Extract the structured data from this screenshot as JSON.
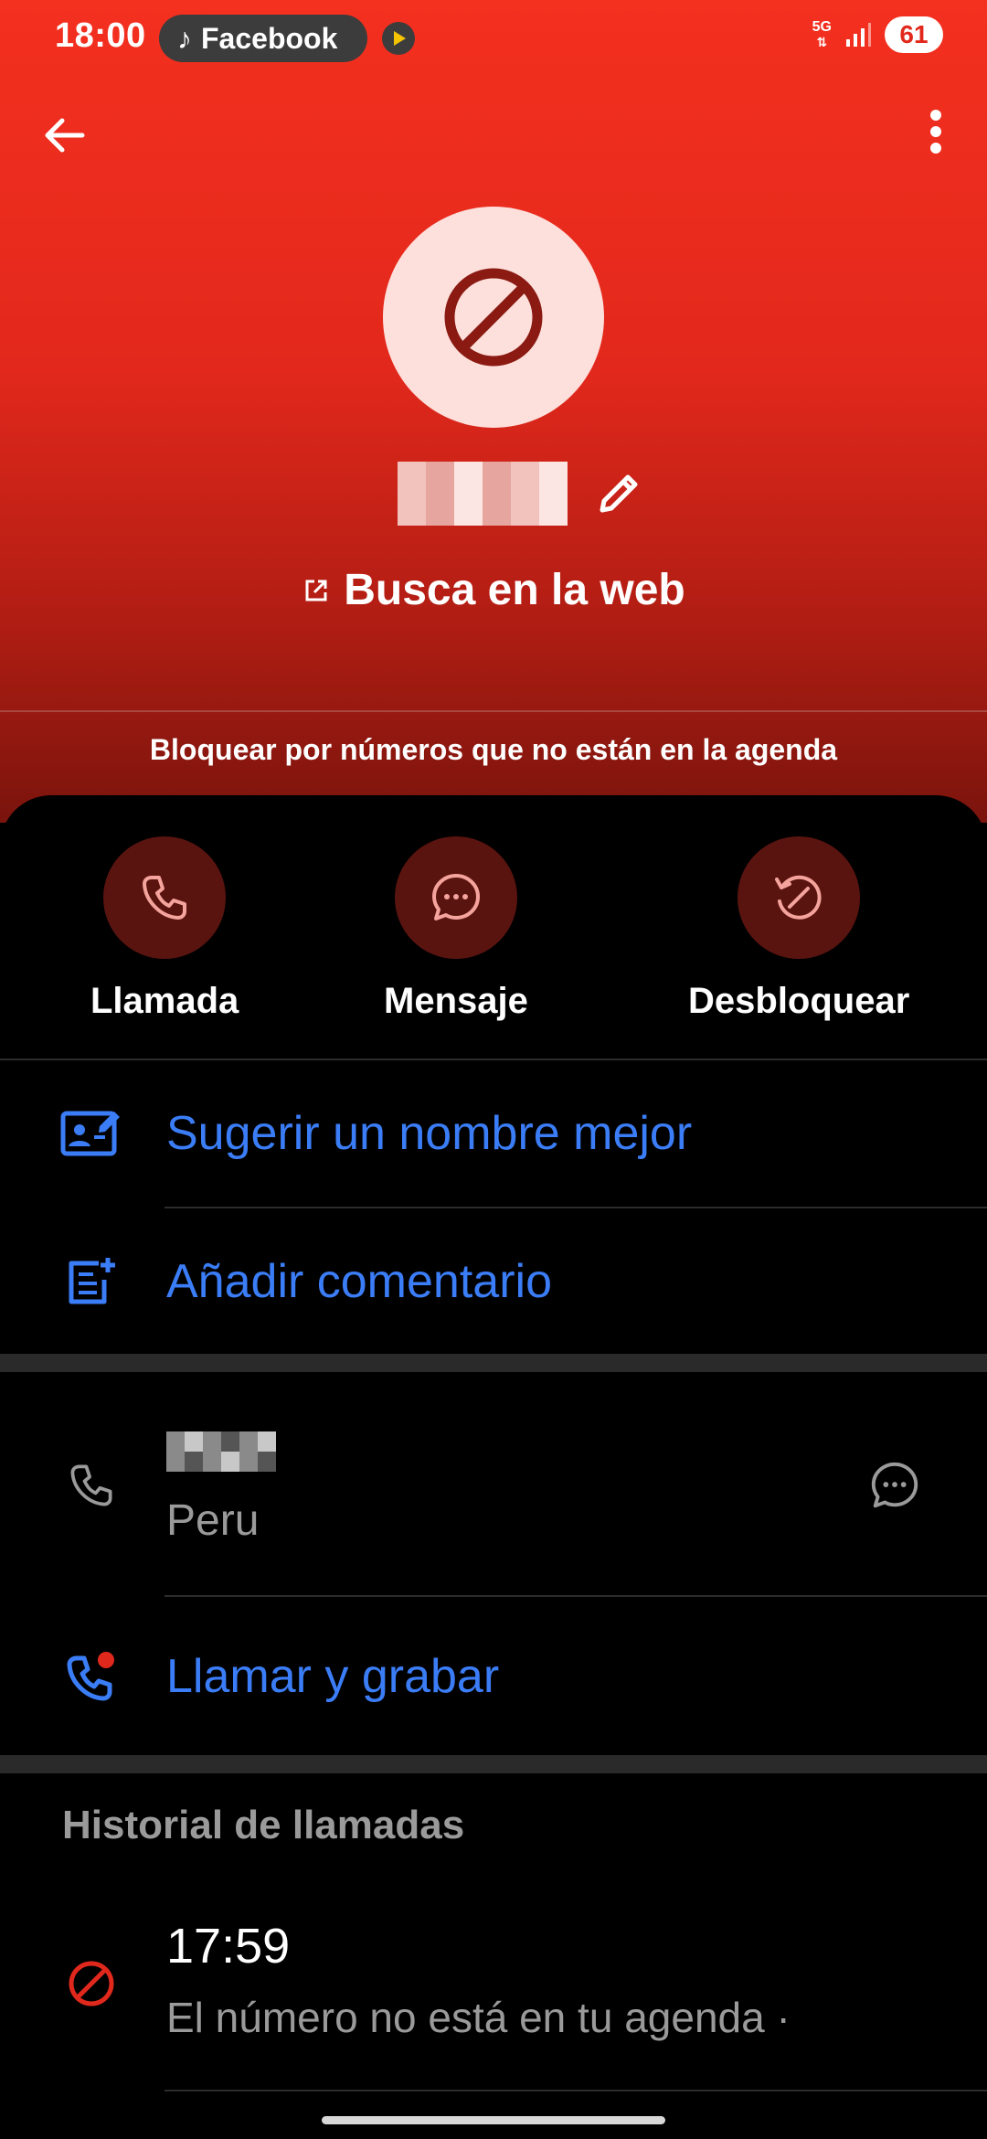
{
  "status_bar": {
    "time": "18:00",
    "notification_app": "Facebook",
    "network": "5G",
    "battery": "61"
  },
  "profile": {
    "web_search_label": "Busca en la web",
    "block_reason": "Bloquear por números que no están en la agenda"
  },
  "actions": [
    {
      "label": "Llamada",
      "icon": "phone-icon"
    },
    {
      "label": "Mensaje",
      "icon": "message-icon"
    },
    {
      "label": "Desbloquear",
      "icon": "unblock-icon"
    }
  ],
  "options": {
    "suggest_name": "Sugerir un nombre mejor",
    "add_comment": "Añadir comentario"
  },
  "number": {
    "location": "Peru",
    "call_and_record": "Llamar y grabar"
  },
  "history": {
    "title": "Historial de llamadas",
    "entries": [
      {
        "time": "17:59",
        "description": "El número no está en tu agenda ·"
      }
    ]
  },
  "colors": {
    "header_top": "#f4301f",
    "header_bottom": "#7a140d",
    "accent_blue": "#3b7df6",
    "action_circle": "#5a1410",
    "blocked_red": "#e0281c"
  }
}
